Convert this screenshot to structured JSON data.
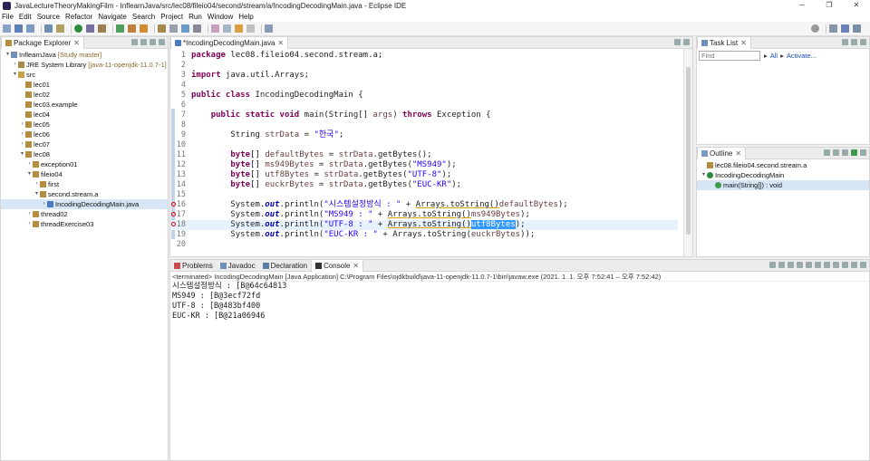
{
  "window": {
    "title": "JavaLectureTheoryMakingFilm - InflearnJava/src/lec08/fileio04/second/stream/a/IncodingDecodingMain.java - Eclipse IDE",
    "controls": [
      "─",
      "❐",
      "✕"
    ]
  },
  "menu": [
    "File",
    "Edit",
    "Source",
    "Refactor",
    "Navigate",
    "Search",
    "Project",
    "Run",
    "Window",
    "Help"
  ],
  "package_explorer": {
    "tab_label": "Package Explorer",
    "tree": [
      {
        "indent": 0,
        "arrow": "▾",
        "icon": "project-icon",
        "label": "InflearnJava",
        "deco": "[Study master]"
      },
      {
        "indent": 1,
        "arrow": "›",
        "icon": "library-icon",
        "label": "JRE System Library",
        "deco": "[java-11-openjdk-11.0.7-1]"
      },
      {
        "indent": 1,
        "arrow": "▾",
        "icon": "src-folder-icon",
        "label": "src",
        "deco": ""
      },
      {
        "indent": 2,
        "arrow": "",
        "icon": "package-icon",
        "label": "lec01",
        "deco": ""
      },
      {
        "indent": 2,
        "arrow": "",
        "icon": "package-icon",
        "label": "lec02",
        "deco": ""
      },
      {
        "indent": 2,
        "arrow": "",
        "icon": "package-icon",
        "label": "lec03.example",
        "deco": ""
      },
      {
        "indent": 2,
        "arrow": "",
        "icon": "package-icon",
        "label": "lec04",
        "deco": ""
      },
      {
        "indent": 2,
        "arrow": "›",
        "icon": "package-icon",
        "label": "lec05",
        "deco": ""
      },
      {
        "indent": 2,
        "arrow": "›",
        "icon": "package-icon",
        "label": "lec06",
        "deco": ""
      },
      {
        "indent": 2,
        "arrow": "›",
        "icon": "package-icon",
        "label": "lec07",
        "deco": ""
      },
      {
        "indent": 2,
        "arrow": "▾",
        "icon": "package-icon",
        "label": "lec08",
        "deco": ""
      },
      {
        "indent": 3,
        "arrow": "›",
        "icon": "package-icon",
        "label": "exception01",
        "deco": ""
      },
      {
        "indent": 3,
        "arrow": "▾",
        "icon": "package-icon",
        "label": "fileio04",
        "deco": ""
      },
      {
        "indent": 4,
        "arrow": "›",
        "icon": "package-icon",
        "label": "first",
        "deco": ""
      },
      {
        "indent": 4,
        "arrow": "▾",
        "icon": "package-icon",
        "label": "second.stream.a",
        "deco": ""
      },
      {
        "indent": 5,
        "arrow": "›",
        "icon": "java-file-icon",
        "label": "IncodingDecodingMain.java",
        "deco": "",
        "selected": true
      },
      {
        "indent": 3,
        "arrow": "›",
        "icon": "package-icon",
        "label": "thread02",
        "deco": ""
      },
      {
        "indent": 3,
        "arrow": "›",
        "icon": "package-icon",
        "label": "threadExercise03",
        "deco": ""
      }
    ]
  },
  "editor": {
    "tab_label": "*IncodingDecodingMain.java",
    "lines": [
      {
        "n": "1",
        "html": "<span class=\"kw\">package</span> lec08.fileio04.second.stream.a;"
      },
      {
        "n": "2",
        "html": ""
      },
      {
        "n": "3",
        "html": "<span class=\"kw\">import</span> java.util.Arrays;"
      },
      {
        "n": "4",
        "html": ""
      },
      {
        "n": "5",
        "html": "<span class=\"kw\">public class</span> IncodingDecodingMain {"
      },
      {
        "n": "6",
        "html": ""
      },
      {
        "n": "7",
        "html": "    <span class=\"kw\">public static void</span> main(String[] <span class=\"lvar\">args</span>) <span class=\"kw\">throws</span> Exception {"
      },
      {
        "n": "8",
        "html": ""
      },
      {
        "n": "9",
        "html": "        String <span class=\"lvar\">strData</span> = <span class=\"str\">\"한국\"</span>;"
      },
      {
        "n": "10",
        "html": ""
      },
      {
        "n": "11",
        "html": "        <span class=\"kw\">byte</span>[] <span class=\"lvar\">defaultBytes</span> = <span class=\"lvar\">strData</span>.getBytes();"
      },
      {
        "n": "12",
        "html": "        <span class=\"kw\">byte</span>[] <span class=\"lvar\">ms949Bytes</span> = <span class=\"lvar\">strData</span>.getBytes(<span class=\"str\">\"MS949\"</span>);"
      },
      {
        "n": "13",
        "html": "        <span class=\"kw\">byte</span>[] <span class=\"lvar\">utf8Bytes</span> = <span class=\"lvar\">strData</span>.getBytes(<span class=\"str\">\"UTF-8\"</span>);"
      },
      {
        "n": "14",
        "html": "        <span class=\"kw\">byte</span>[] <span class=\"lvar\">euckrBytes</span> = <span class=\"lvar\">strData</span>.getBytes(<span class=\"str\">\"EUC-KR\"</span>);"
      },
      {
        "n": "15",
        "html": ""
      },
      {
        "n": "16",
        "html": "        System.<span class=\"fld\">out</span>.println(<span class=\"str\">\"시스템설정방식 : \"</span> + <span class=\"warnu\">Arrays.toString()</span><span class=\"lvar\">defaultBytes</span>);"
      },
      {
        "n": "17",
        "html": "        System.<span class=\"fld\">out</span>.println(<span class=\"str\">\"MS949 : \"</span> + <span class=\"warnu\">Arrays.toString()</span><span class=\"lvar\">ms949Bytes</span>);"
      },
      {
        "n": "18",
        "html": "        System.<span class=\"fld\">out</span>.println(<span class=\"str\">\"UTF-8 : \"</span> + <span class=\"warnu\">Arrays.toString()</span><span class=\"sel\">utf8Bytes</span>);"
      },
      {
        "n": "19",
        "html": "        System.<span class=\"fld\">out</span>.println(<span class=\"str\">\"EUC-KR : \"</span> + Arrays.toString(<span class=\"lvar\">euckrBytes</span>));"
      },
      {
        "n": "20",
        "html": ""
      }
    ]
  },
  "task_list": {
    "tab_label": "Task List",
    "find_placeholder": "Find",
    "all_label": "All",
    "activate_label": "Activate..."
  },
  "outline": {
    "tab_label": "Outline",
    "items": [
      {
        "indent": 0,
        "icon": "package-icon",
        "label": "lec08.fileio04.second.stream.a",
        "selected": false
      },
      {
        "indent": 0,
        "icon": "class-icon",
        "label": "IncodingDecodingMain",
        "selected": false,
        "arrow": "▾"
      },
      {
        "indent": 1,
        "icon": "method-icon",
        "label": "main(String[]) : void",
        "selected": true
      }
    ]
  },
  "bottom_panel": {
    "tabs": [
      "Problems",
      "Javadoc",
      "Declaration",
      "Console"
    ],
    "active_tab": "Console",
    "status": "<terminated> IncodingDecodingMain [Java Application] C:\\Program Files\\ojdkbuild\\java-11-openjdk-11.0.7-1\\bin\\javaw.exe  (2021. 1. 1. 오후 7:52:41 – 오후 7:52:42)",
    "output": [
      "시스템설정방식 : [B@64c64813",
      "MS949 : [B@3ecf72fd",
      "UTF-8 : [B@483bf400",
      "EUC-KR : [B@21a06946"
    ]
  },
  "colors": {
    "keyword": "#7f0055",
    "string": "#2a00ff",
    "selection": "#3399ff",
    "current_line": "#e8f2fe"
  }
}
